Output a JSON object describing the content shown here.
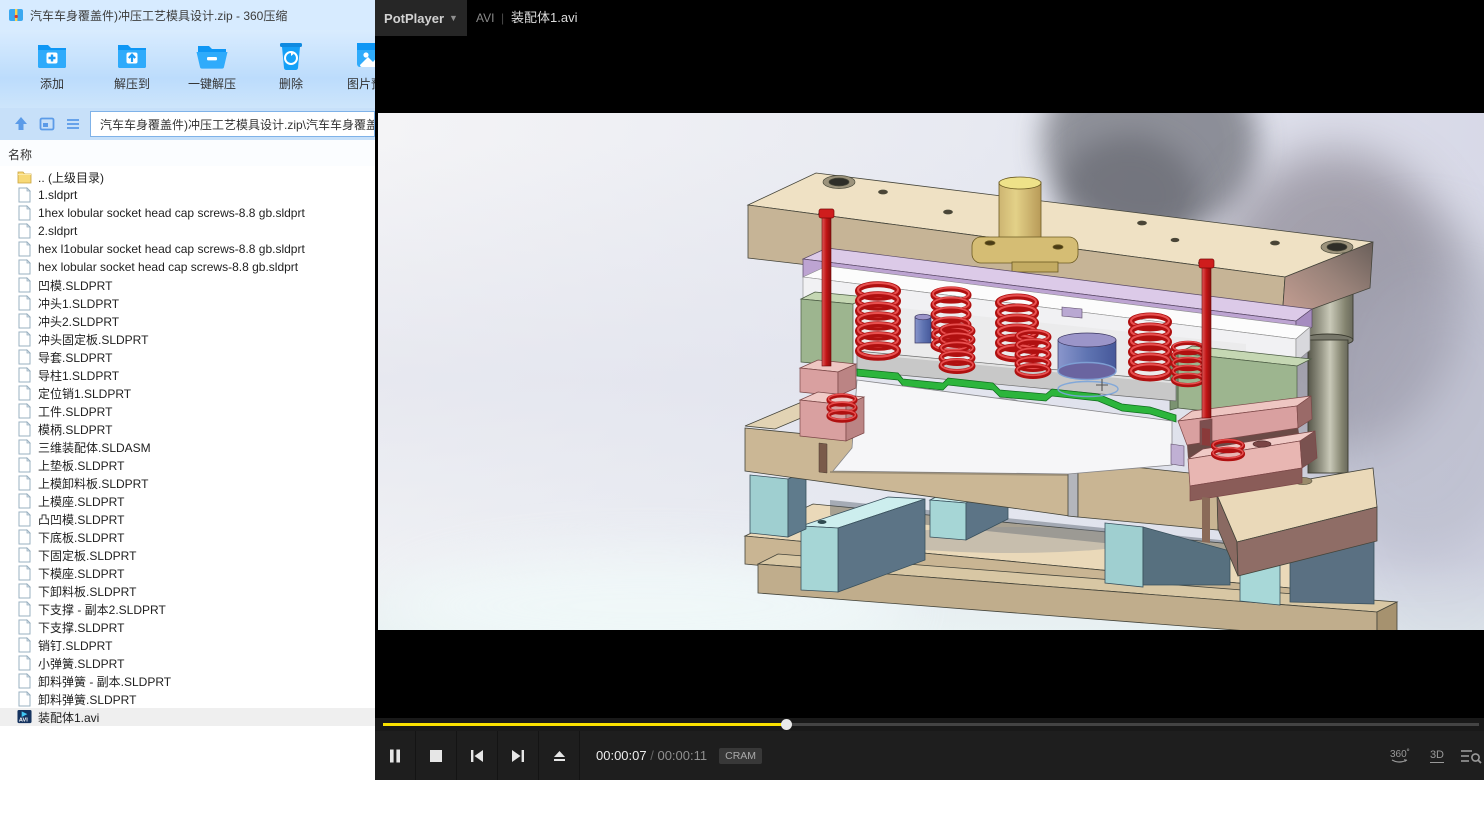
{
  "archive_window": {
    "title": "汽车车身覆盖件)冲压工艺模具设计.zip - 360压缩",
    "toolbar": [
      {
        "id": "add",
        "label": "添加"
      },
      {
        "id": "extract-to",
        "label": "解压到"
      },
      {
        "id": "one-click-extract",
        "label": "一键解压"
      },
      {
        "id": "delete",
        "label": "删除"
      },
      {
        "id": "image-preview",
        "label": "图片预览"
      }
    ],
    "address": "汽车车身覆盖件)冲压工艺模具设计.zip\\汽车车身覆盖件",
    "column_header": "名称",
    "files": [
      {
        "name": ".. (上级目录)",
        "type": "parent-folder"
      },
      {
        "name": "1.sldprt",
        "type": "file"
      },
      {
        "name": "1hex lobular socket head cap screws-8.8 gb.sldprt",
        "type": "file"
      },
      {
        "name": "2.sldprt",
        "type": "file"
      },
      {
        "name": "hex l1obular socket head cap screws-8.8 gb.sldprt",
        "type": "file"
      },
      {
        "name": "hex lobular socket head cap screws-8.8 gb.sldprt",
        "type": "file"
      },
      {
        "name": "凹模.SLDPRT",
        "type": "file"
      },
      {
        "name": "冲头1.SLDPRT",
        "type": "file"
      },
      {
        "name": "冲头2.SLDPRT",
        "type": "file"
      },
      {
        "name": "冲头固定板.SLDPRT",
        "type": "file"
      },
      {
        "name": "导套.SLDPRT",
        "type": "file"
      },
      {
        "name": "导柱1.SLDPRT",
        "type": "file"
      },
      {
        "name": "定位销1.SLDPRT",
        "type": "file"
      },
      {
        "name": "工件.SLDPRT",
        "type": "file"
      },
      {
        "name": "模柄.SLDPRT",
        "type": "file"
      },
      {
        "name": "三维装配体.SLDASM",
        "type": "file"
      },
      {
        "name": "上垫板.SLDPRT",
        "type": "file"
      },
      {
        "name": "上模卸料板.SLDPRT",
        "type": "file"
      },
      {
        "name": "上模座.SLDPRT",
        "type": "file"
      },
      {
        "name": "凸凹模.SLDPRT",
        "type": "file"
      },
      {
        "name": "下底板.SLDPRT",
        "type": "file"
      },
      {
        "name": "下固定板.SLDPRT",
        "type": "file"
      },
      {
        "name": "下模座.SLDPRT",
        "type": "file"
      },
      {
        "name": "下卸料板.SLDPRT",
        "type": "file"
      },
      {
        "name": "下支撑 - 副本2.SLDPRT",
        "type": "file"
      },
      {
        "name": "下支撑.SLDPRT",
        "type": "file"
      },
      {
        "name": "销钉.SLDPRT",
        "type": "file"
      },
      {
        "name": "小弹簧.SLDPRT",
        "type": "file"
      },
      {
        "name": "卸料弹簧 - 副本.SLDPRT",
        "type": "file"
      },
      {
        "name": "卸料弹簧.SLDPRT",
        "type": "file"
      },
      {
        "name": "装配体1.avi",
        "type": "video",
        "selected": true
      }
    ]
  },
  "player": {
    "app_name": "PotPlayer",
    "format_label": "AVI",
    "media_title": "装配体1.avi",
    "time_current": "00:00:07",
    "time_total": "00:00:11",
    "codec_badge": "CRAM",
    "seek_fraction": 0.368,
    "accent_color": "#fae100",
    "right_icons": [
      "360-rotation",
      "3d-mode",
      "playlist-search"
    ]
  }
}
